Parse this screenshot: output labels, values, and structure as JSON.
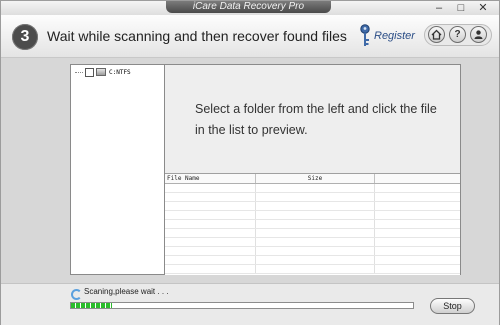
{
  "window": {
    "title": "iCare Data Recovery Pro",
    "controls": {
      "minimize": "–",
      "maximize": "□",
      "close": "✕"
    }
  },
  "header": {
    "step_number": "3",
    "step_text": "Wait while scanning and then recover found files",
    "register_label": "Register",
    "icons": [
      "key-icon",
      "home-icon",
      "help-icon",
      "user-icon"
    ],
    "help_glyph": "?"
  },
  "tree": {
    "items": [
      {
        "label": "C:NTFS",
        "checked": false
      }
    ]
  },
  "preview": {
    "message": "Select a folder from the left and click the file in the list to preview."
  },
  "file_list": {
    "columns": [
      "File Name",
      "Size"
    ],
    "rows": []
  },
  "status": {
    "text": "Scaning,please wait . . .",
    "progress_fraction": 0.12
  },
  "buttons": {
    "stop_label": "Stop"
  },
  "colors": {
    "progress": "#2bbd2b",
    "register_link": "#2a4d86",
    "step_circle": "#4c4c4c"
  }
}
